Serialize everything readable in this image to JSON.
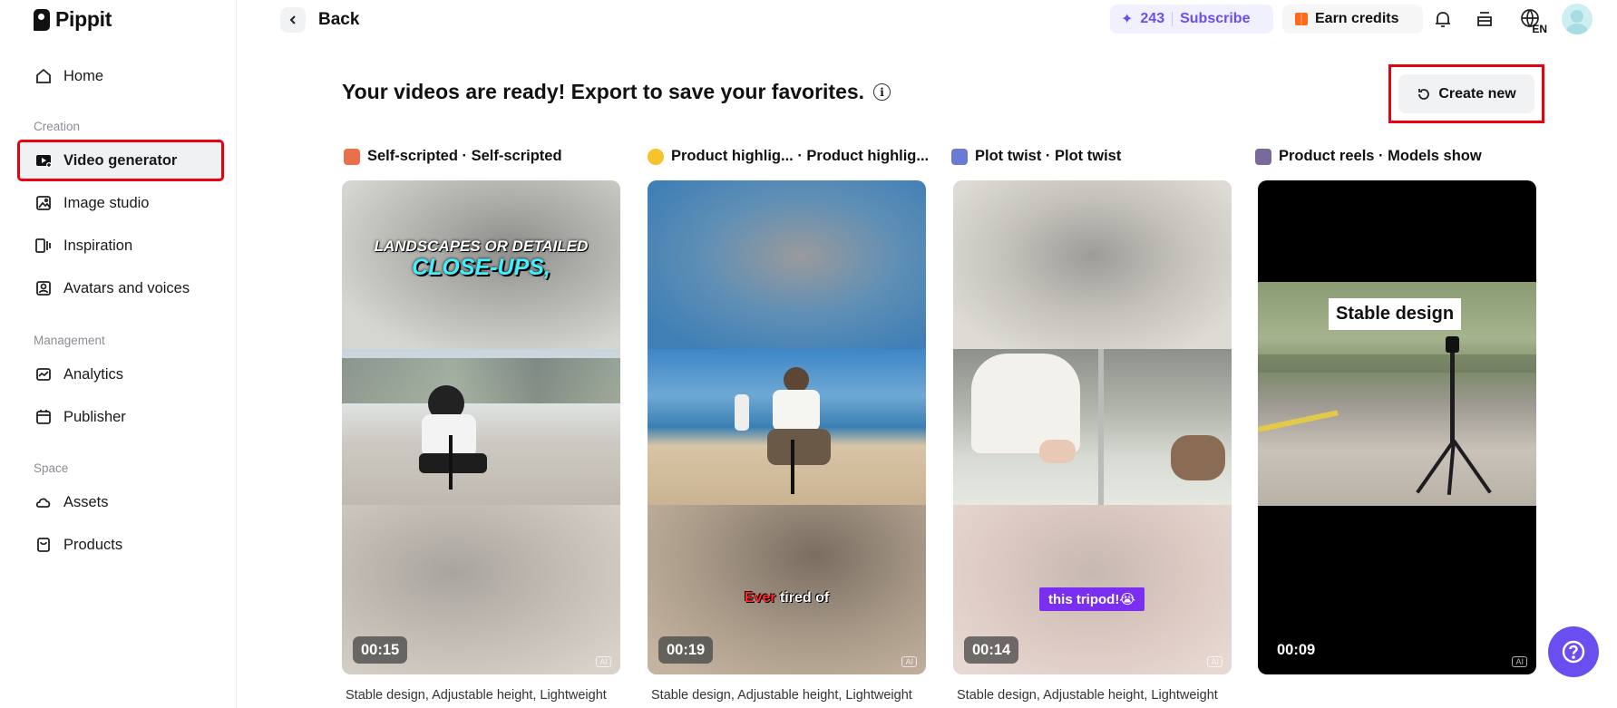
{
  "brand": {
    "name": "Pippit"
  },
  "sidebar": {
    "home": "Home",
    "sections": [
      {
        "label": "Creation"
      },
      {
        "label": "Management"
      },
      {
        "label": "Space"
      }
    ],
    "items": [
      {
        "label": "Video generator",
        "icon": "video-generator-icon"
      },
      {
        "label": "Image studio",
        "icon": "image-studio-icon"
      },
      {
        "label": "Inspiration",
        "icon": "inspiration-icon"
      },
      {
        "label": "Avatars and voices",
        "icon": "avatar-icon"
      },
      {
        "label": "Analytics",
        "icon": "analytics-icon"
      },
      {
        "label": "Publisher",
        "icon": "calendar-icon"
      },
      {
        "label": "Assets",
        "icon": "cloud-icon"
      },
      {
        "label": "Products",
        "icon": "product-icon"
      }
    ]
  },
  "header": {
    "back_label": "Back",
    "credits": "243",
    "subscribe_label": "Subscribe",
    "earn_label": "Earn credits",
    "language": "EN"
  },
  "main": {
    "heading": "Your videos are ready! Export to save your favorites.",
    "create_new_label": "Create new",
    "cards": [
      {
        "title": "Self-scripted · Self-scripted",
        "overlay_line1": "LANDSCAPES OR DETAILED",
        "overlay_line2": "CLOSE-UPS,",
        "duration": "00:15",
        "ai": "AI",
        "description": "Stable design, Adjustable height, Lightweight"
      },
      {
        "title": "Product highlig...  · Product highlig...",
        "overlay_red": "Ever",
        "overlay_white": " tired of",
        "duration": "00:19",
        "ai": "AI",
        "description": "Stable design, Adjustable height, Lightweight"
      },
      {
        "title": "Plot twist · Plot twist",
        "overlay_tag": "this tripod!😭",
        "duration": "00:14",
        "ai": "AI",
        "description": "Stable design, Adjustable height, Lightweight"
      },
      {
        "title": "Product reels · Models show",
        "overlay_tag": "Stable design",
        "duration": "00:09",
        "ai": "AI",
        "description": ""
      }
    ]
  },
  "colors": {
    "accent": "#6b4ef0",
    "highlight": "#e60012"
  }
}
